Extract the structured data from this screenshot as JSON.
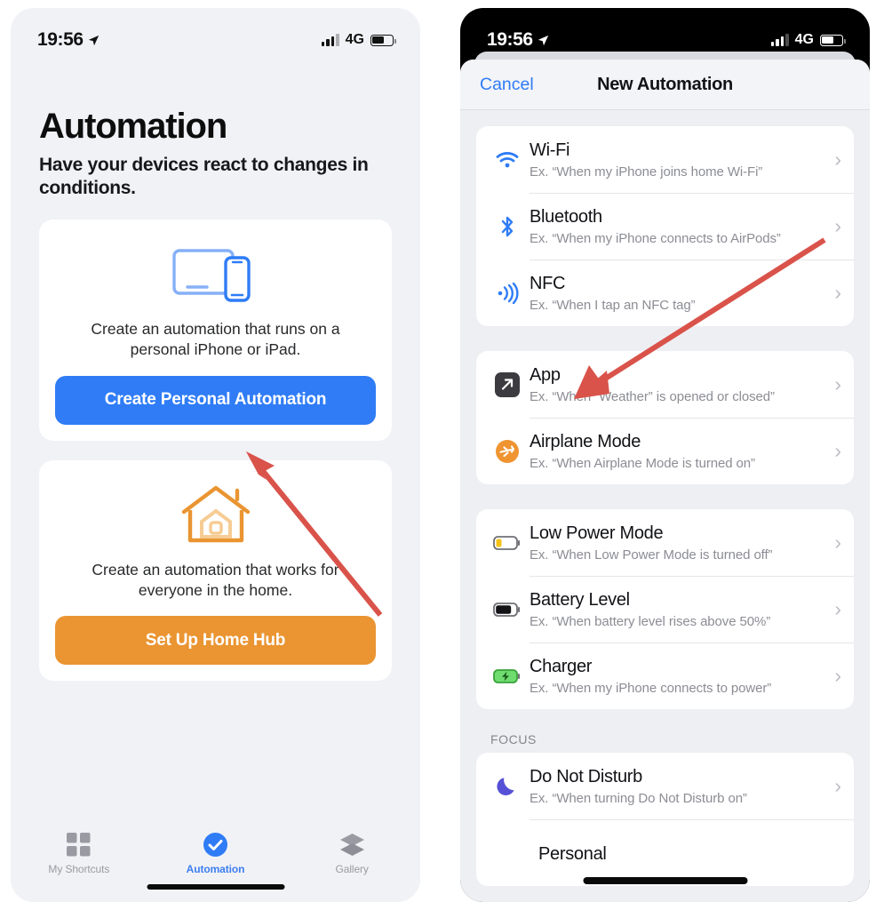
{
  "colors": {
    "accent_blue": "#2f7cf6",
    "accent_orange": "#ea9532",
    "arrow_red": "#d9534a",
    "screen_bg": "#f1f2f6",
    "card_bg": "#ffffff",
    "muted_text": "#8c8d94"
  },
  "left_phone": {
    "status_bar": {
      "time": "19:56",
      "location_icon": "location-arrow-icon",
      "signal_icon": "cellular-bars-icon",
      "network": "4G",
      "battery_icon": "battery-icon"
    },
    "page_title": "Automation",
    "page_subtitle": "Have your devices react to changes in conditions.",
    "cards": [
      {
        "illustration_icon": "ipad-iphone-devices-icon",
        "description": "Create an automation that runs on a personal iPhone or iPad.",
        "button_label": "Create Personal Automation",
        "button_color": "#2f7cf6"
      },
      {
        "illustration_icon": "home-house-icon",
        "description": "Create an automation that works for everyone in the home.",
        "button_label": "Set Up Home Hub",
        "button_color": "#ea9532"
      }
    ],
    "tab_bar": [
      {
        "label": "My Shortcuts",
        "icon": "grid-squares-icon",
        "active": false
      },
      {
        "label": "Automation",
        "icon": "check-circle-icon",
        "active": true
      },
      {
        "label": "Gallery",
        "icon": "stacked-layers-icon",
        "active": false
      }
    ]
  },
  "right_phone": {
    "status_bar": {
      "time": "19:56",
      "location_icon": "location-arrow-icon",
      "signal_icon": "cellular-bars-icon",
      "network": "4G",
      "battery_icon": "battery-icon"
    },
    "nav": {
      "cancel_label": "Cancel",
      "title": "New Automation"
    },
    "groups": [
      {
        "header": "",
        "rows": [
          {
            "title": "Wi-Fi",
            "example": "Ex. “When my iPhone joins home Wi-Fi”",
            "icon": "wifi-icon"
          },
          {
            "title": "Bluetooth",
            "example": "Ex. “When my iPhone connects to AirPods”",
            "icon": "bluetooth-icon"
          },
          {
            "title": "NFC",
            "example": "Ex. “When I tap an NFC tag”",
            "icon": "nfc-icon"
          }
        ]
      },
      {
        "header": "",
        "rows": [
          {
            "title": "App",
            "example": "Ex. “When “Weather” is opened or closed”",
            "icon": "app-launch-icon"
          },
          {
            "title": "Airplane Mode",
            "example": "Ex. “When Airplane Mode is turned on”",
            "icon": "airplane-icon"
          }
        ]
      },
      {
        "header": "",
        "rows": [
          {
            "title": "Low Power Mode",
            "example": "Ex. “When Low Power Mode is turned off”",
            "icon": "battery-low-icon"
          },
          {
            "title": "Battery Level",
            "example": "Ex. “When battery level rises above 50%”",
            "icon": "battery-full-icon"
          },
          {
            "title": "Charger",
            "example": "Ex. “When my iPhone connects to power”",
            "icon": "battery-charging-icon"
          }
        ]
      },
      {
        "header": "FOCUS",
        "rows": [
          {
            "title": "Do Not Disturb",
            "example": "Ex. “When turning Do Not Disturb on”",
            "icon": "moon-icon"
          }
        ]
      }
    ],
    "partial_row_title": "Personal"
  },
  "annotations": [
    {
      "name": "arrow-to-create-personal-automation",
      "color": "#d9534a"
    },
    {
      "name": "arrow-to-app-trigger",
      "color": "#d9534a"
    }
  ]
}
